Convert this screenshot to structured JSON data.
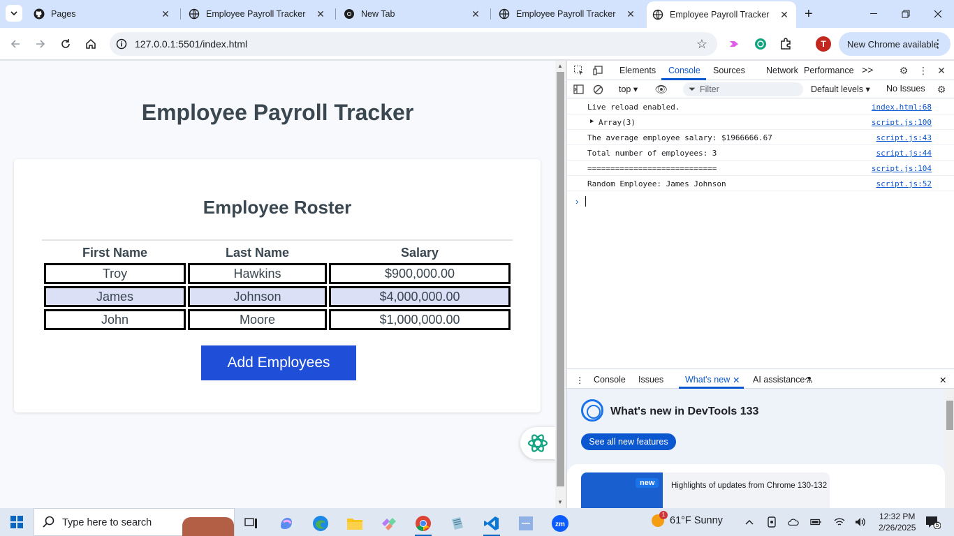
{
  "browser": {
    "tabs": [
      {
        "title": "Pages",
        "icon": "github-icon"
      },
      {
        "title": "Employee Payroll Tracker",
        "icon": "globe-icon"
      },
      {
        "title": "New Tab",
        "icon": "chrome-icon"
      },
      {
        "title": "Employee Payroll Tracker",
        "icon": "globe-icon"
      },
      {
        "title": "Employee Payroll Tracker",
        "icon": "globe-icon",
        "active": true
      }
    ],
    "url": "127.0.0.1:5501/index.html",
    "profile_initial": "T",
    "update_label": "New Chrome available"
  },
  "page": {
    "title": "Employee Payroll Tracker",
    "roster_title": "Employee Roster",
    "columns": [
      "First Name",
      "Last Name",
      "Salary"
    ],
    "rows": [
      {
        "first": "Troy",
        "last": "Hawkins",
        "salary": "$900,000.00"
      },
      {
        "first": "James",
        "last": "Johnson",
        "salary": "$4,000,000.00"
      },
      {
        "first": "John",
        "last": "Moore",
        "salary": "$1,000,000.00"
      }
    ],
    "add_button": "Add Employees"
  },
  "devtools": {
    "tabs": [
      "Elements",
      "Console",
      "Sources",
      "Network",
      "Performance"
    ],
    "active_tab": "Console",
    "more": ">>",
    "context": "top ▾",
    "filter_placeholder": "Filter",
    "levels": "Default levels ▾",
    "issues": "No Issues",
    "console_lines": [
      {
        "msg": "Live reload enabled.",
        "src": "index.html:68"
      },
      {
        "msg": "Array(3)",
        "src": "script.js:100",
        "expandable": true
      },
      {
        "msg": "The average employee salary: $1966666.67",
        "src": "script.js:43"
      },
      {
        "msg": "Total number of employees: 3",
        "src": "script.js:44"
      },
      {
        "msg": "============================",
        "src": "script.js:104"
      },
      {
        "msg": "Random Employee: James Johnson",
        "src": "script.js:52"
      }
    ],
    "prompt": "›",
    "drawer": {
      "tabs": [
        "Console",
        "Issues",
        "What's new",
        "AI assistance"
      ],
      "active": "What's new",
      "whats_new_title": "What's new in DevTools 133",
      "see_all": "See all new features",
      "badge": "new",
      "highlight": "Highlights of updates from Chrome 130-132"
    }
  },
  "taskbar": {
    "search_placeholder": "Type here to search",
    "weather": "61°F  Sunny",
    "weather_badge": "1",
    "time": "12:32 PM",
    "date": "2/26/2025",
    "notification_count": "5"
  },
  "colors": {
    "accent_button": "#1f4ed8",
    "alt_row": "#dbe0f7",
    "devtools_blue": "#0b57d0"
  }
}
